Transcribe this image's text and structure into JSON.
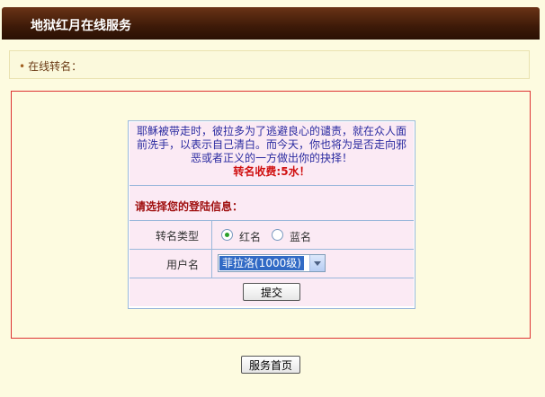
{
  "header": {
    "title": "地狱红月在线服务"
  },
  "breadcrumb": {
    "bullet": "•",
    "text": "在线转名："
  },
  "notice": {
    "line1": "耶稣被带走时，彼拉多为了逃避良心的谴责，就在众人面",
    "line2": "前洗手，以表示自己清白。而今天，你也将为是否走向邪",
    "line3": "恶或者正义的一方做出你的抉择！",
    "fee": "转名收费:5水！"
  },
  "form": {
    "section_label": "请选择您的登陆信息：",
    "type_label": "转名类型",
    "type_options": [
      {
        "label": "红名",
        "selected": true
      },
      {
        "label": "蓝名",
        "selected": false
      }
    ],
    "user_label": "用户名",
    "user_selected": "菲拉洛(1000级)",
    "submit_label": "提交"
  },
  "footer": {
    "home_button": "服务首页"
  },
  "colors": {
    "header_bg": "#3d1a08",
    "page_bg": "#fdfbe0",
    "panel_border": "#dd3333",
    "form_bg": "#fbeaf4",
    "notice_text": "#2a2aa0",
    "fee_text": "#d01010",
    "section_label": "#a01010"
  }
}
